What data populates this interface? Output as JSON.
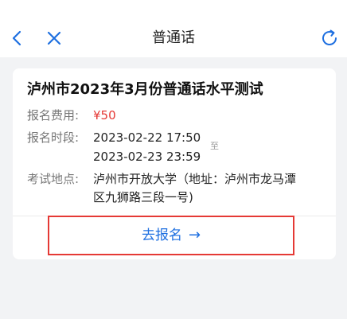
{
  "header": {
    "title": "普通话",
    "back_icon": "back-icon",
    "close_icon": "close-icon",
    "refresh_icon": "refresh-icon"
  },
  "exam": {
    "title": "泸州市2023年3月份普通话水平测试",
    "fee_label": "报名费用:",
    "fee_value": "¥50",
    "period_label": "报名时段:",
    "period_start": "2023-02-22 17:50",
    "period_to": "至",
    "period_end": "2023-02-23 23:59",
    "location_label": "考试地点:",
    "location_line1": "泸州市开放大学（地址：泸州市龙马潭",
    "location_line2": "区九狮路三段一号)",
    "action_label": "去报名",
    "action_arrow": "→"
  },
  "colors": {
    "accent": "#1e6fe0",
    "price": "#e53935",
    "highlight_border": "#e53935"
  }
}
